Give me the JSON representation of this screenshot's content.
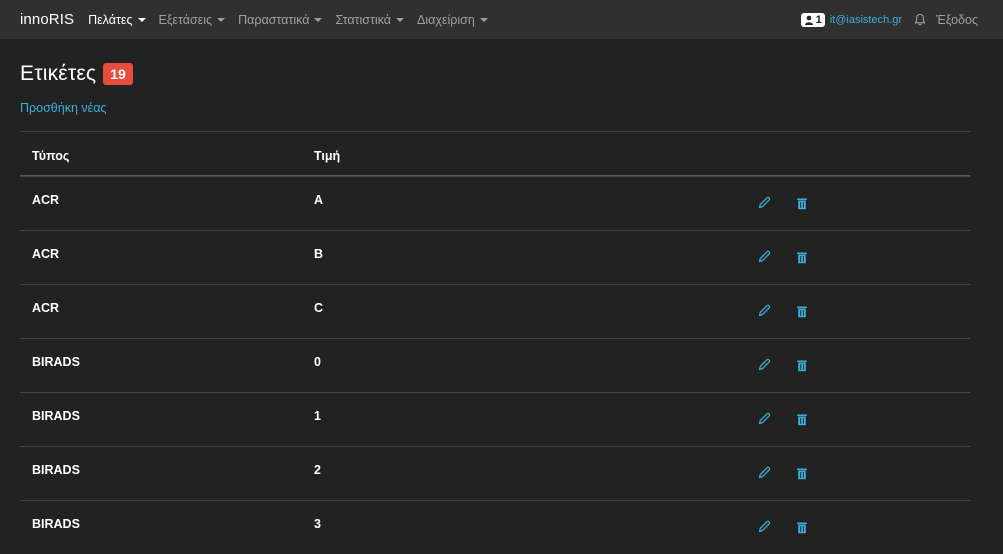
{
  "app": {
    "brand": "innoRIS"
  },
  "nav": {
    "items": [
      {
        "label": "Πελάτες"
      },
      {
        "label": "Εξετάσεις"
      },
      {
        "label": "Παραστατικά"
      },
      {
        "label": "Στατιστικά"
      },
      {
        "label": "Διαχείριση"
      }
    ],
    "user_count": "1",
    "user_email": "it@iasistech.gr",
    "logout_label": "Έξοδος",
    "icons": {
      "user": "user-icon",
      "bell": "bell-icon",
      "caret": "chevron-down-icon"
    }
  },
  "page": {
    "title": "Ετικέτες",
    "count": "19",
    "add_link": "Προσθήκη νέας"
  },
  "table": {
    "columns": [
      "Τύπος",
      "Τιμή"
    ],
    "rows": [
      {
        "type": "ACR",
        "value": "A"
      },
      {
        "type": "ACR",
        "value": "B"
      },
      {
        "type": "ACR",
        "value": "C"
      },
      {
        "type": "BIRADS",
        "value": "0"
      },
      {
        "type": "BIRADS",
        "value": "1"
      },
      {
        "type": "BIRADS",
        "value": "2"
      },
      {
        "type": "BIRADS",
        "value": "3"
      }
    ],
    "row_actions": {
      "edit_icon": "pencil-icon",
      "delete_icon": "trash-icon"
    }
  },
  "colors": {
    "background": "#222222",
    "navbar": "#303030",
    "accent": "#3bafda",
    "badge": "#e74c3c",
    "border": "#444444"
  }
}
